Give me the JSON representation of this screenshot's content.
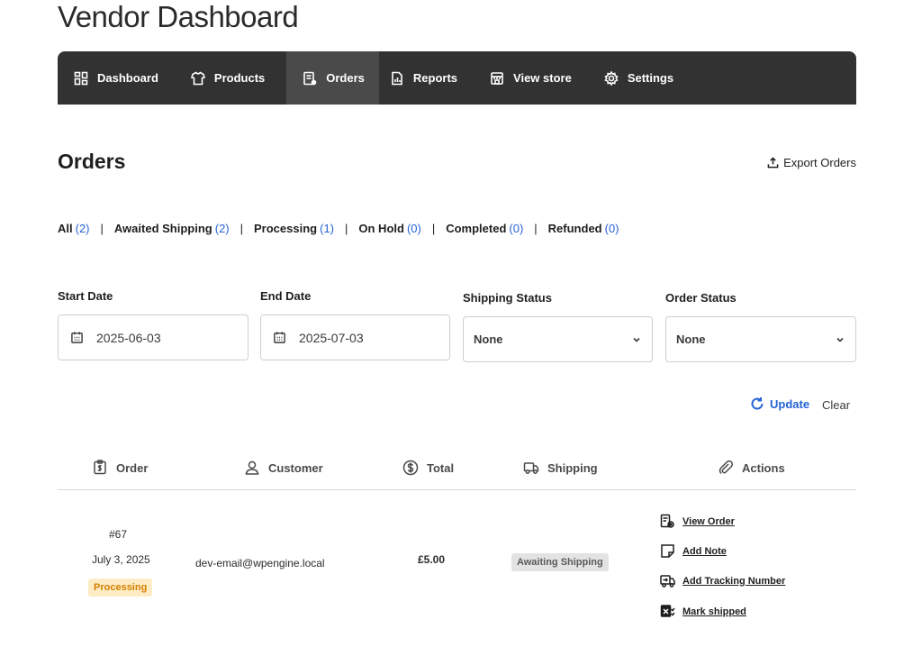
{
  "app": {
    "title": "Vendor Dashboard"
  },
  "nav": [
    {
      "label": "Dashboard",
      "icon": "dashboard-grid-icon",
      "active": false
    },
    {
      "label": "Products",
      "icon": "tshirt-icon",
      "active": false
    },
    {
      "label": "Orders",
      "icon": "orders-list-icon",
      "active": true
    },
    {
      "label": "Reports",
      "icon": "report-chart-icon",
      "active": false
    },
    {
      "label": "View store",
      "icon": "store-icon",
      "active": false
    },
    {
      "label": "Settings",
      "icon": "gear-icon",
      "active": false
    }
  ],
  "orders_page": {
    "title": "Orders",
    "export_label": "Export Orders",
    "filters": [
      {
        "label": "All",
        "count": "(2)"
      },
      {
        "label": "Awaited Shipping",
        "count": "(2)"
      },
      {
        "label": "Processing",
        "count": "(1)"
      },
      {
        "label": "On Hold",
        "count": "(0)"
      },
      {
        "label": "Completed",
        "count": "(0)"
      },
      {
        "label": "Refunded",
        "count": "(0)"
      }
    ],
    "separator": "|",
    "start_date": {
      "label": "Start Date",
      "value": "2025-06-03"
    },
    "end_date": {
      "label": "End Date",
      "value": "2025-07-03"
    },
    "shipping_status": {
      "label": "Shipping Status",
      "value": "None"
    },
    "order_status": {
      "label": "Order Status",
      "value": "None"
    },
    "update_label": "Update",
    "clear_label": "Clear"
  },
  "table": {
    "columns": [
      "Order",
      "Customer",
      "Total",
      "Shipping",
      "Actions"
    ],
    "rows": [
      {
        "order_id": "#67",
        "date": "July 3, 2025",
        "status": "Processing",
        "customer": "dev-email@wpengine.local",
        "total": "£5.00",
        "shipping": "Awaiting Shipping",
        "actions": [
          "View Order",
          "Add Note",
          "Add Tracking Number",
          "Mark shipped"
        ]
      }
    ]
  },
  "colors": {
    "nav_bg": "#323232",
    "nav_active_bg": "#4a4a4a",
    "link_blue": "#2563d6",
    "processing_badge_bg": "#fdecc4",
    "processing_badge_text": "#d57e00",
    "shipping_badge_bg": "#e3e3e3"
  }
}
